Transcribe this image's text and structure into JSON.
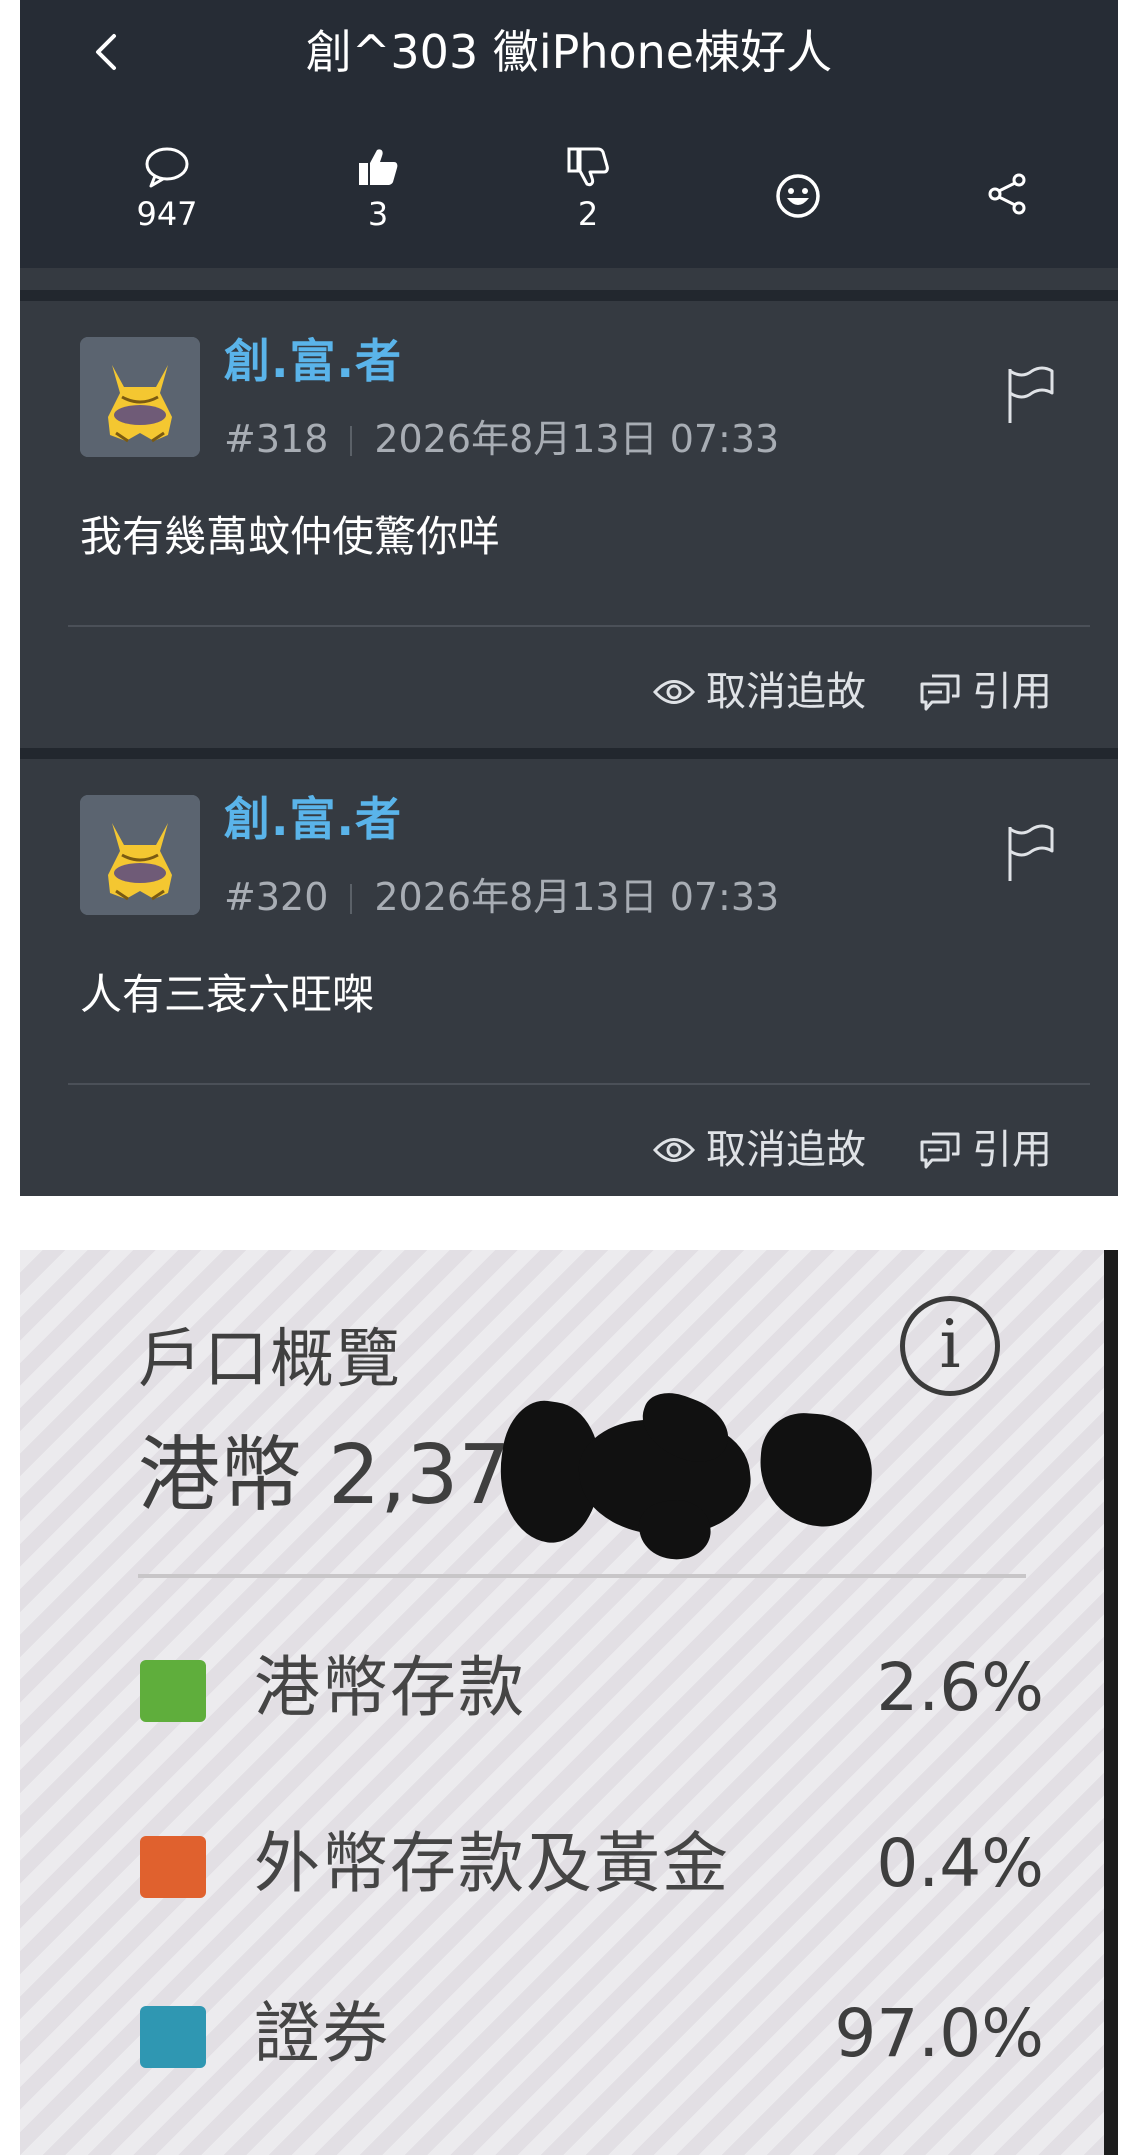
{
  "thread": {
    "title": "創^303 黴iPhone棟好人",
    "replies": "947",
    "likes": "3",
    "dislikes": "2"
  },
  "posts": [
    {
      "username": "創.富.者",
      "number": "#318",
      "datetime": "2026年8月13日 07:33",
      "content": "我有幾萬蚊仲使驚你咩",
      "unfollow_label": "取消追故",
      "quote_label": "引用"
    },
    {
      "username": "創.富.者",
      "number": "#320",
      "datetime": "2026年8月13日 07:33",
      "content": "人有三衰六旺㗎",
      "unfollow_label": "取消追故",
      "quote_label": "引用"
    }
  ],
  "photo": {
    "title": "戶口概覽",
    "info_symbol": "i",
    "amount_visible": "港幣 2,37",
    "rows": [
      {
        "label": "港幣存款",
        "percent": "2.6%",
        "color": "#5fae3c"
      },
      {
        "label": "外幣存款及黃金",
        "percent": "0.4%",
        "color": "#e0612e"
      },
      {
        "label": "證券",
        "percent": "97.0%",
        "color": "#2f97b2"
      }
    ]
  },
  "colors": {
    "header_bg": "#262c35",
    "post_bg": "#353a41",
    "username": "#5ab4ea"
  }
}
